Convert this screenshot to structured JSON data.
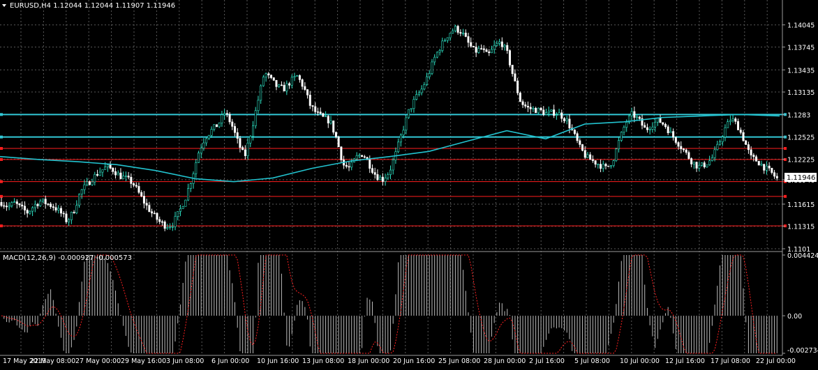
{
  "symbol_header": "EURUSD,H4  1.12044 1.12044 1.11907 1.11946",
  "macd_header": "MACD(12,26,9) -0.000927 -0.000573",
  "current_price_label": "1.11946",
  "colors": {
    "background": "#000000",
    "grid": "#5a5a5a",
    "axis_text": "#ffffff",
    "candle": "#ffffff",
    "bull_wick": "#2ee6c8",
    "ma_line": "#22c3cf",
    "resistance_line": "#32c8d6",
    "support_line": "#ff1e1e",
    "macd_hist": "#bdbdbd",
    "macd_signal": "#ff2020"
  },
  "icons": {
    "symbol_menu": "triangle-down-icon"
  },
  "chart_data": [
    {
      "type": "candlestick",
      "series_shown": "EURUSD,H4",
      "price_axis_ticks": [
        1.14045,
        1.13745,
        1.13435,
        1.13135,
        1.1283,
        1.12525,
        1.12225,
        1.11946,
        1.11615,
        1.11315,
        1.1101
      ],
      "ylim": [
        1.1101,
        1.1425
      ],
      "x_ticks": [
        "17 May 2019",
        "22 May 08:00",
        "27 May 00:00",
        "29 May 16:00",
        "3 Jun 08:00",
        "6 Jun 00:00",
        "10 Jun 16:00",
        "13 Jun 08:00",
        "18 Jun 00:00",
        "20 Jun 16:00",
        "25 Jun 08:00",
        "28 Jun 00:00",
        "2 Jul 16:00",
        "5 Jul 08:00",
        "10 Jul 00:00",
        "12 Jul 16:00",
        "17 Jul 08:00",
        "22 Jul 00:00"
      ],
      "path_closes": [
        1.1164,
        1.1158,
        1.1163,
        1.1156,
        1.115,
        1.116,
        1.1166,
        1.1162,
        1.1158,
        1.115,
        1.1138,
        1.1152,
        1.1178,
        1.1188,
        1.1198,
        1.1206,
        1.1212,
        1.1208,
        1.12,
        1.1196,
        1.119,
        1.1175,
        1.116,
        1.1148,
        1.1138,
        1.1132,
        1.1134,
        1.115,
        1.117,
        1.1198,
        1.1232,
        1.1252,
        1.1262,
        1.127,
        1.1286,
        1.127,
        1.1245,
        1.1225,
        1.126,
        1.13,
        1.134,
        1.133,
        1.132,
        1.1318,
        1.1328,
        1.1335,
        1.132,
        1.1295,
        1.1284,
        1.1278,
        1.1274,
        1.125,
        1.1215,
        1.121,
        1.1225,
        1.123,
        1.1215,
        1.12,
        1.1195,
        1.1205,
        1.123,
        1.126,
        1.1288,
        1.1305,
        1.1318,
        1.1338,
        1.1362,
        1.1378,
        1.1392,
        1.14,
        1.1395,
        1.138,
        1.1368,
        1.1372,
        1.1362,
        1.1375,
        1.1382,
        1.1365,
        1.133,
        1.13,
        1.1292,
        1.129,
        1.1288,
        1.1284,
        1.1286,
        1.1283,
        1.1275,
        1.1258,
        1.1238,
        1.1225,
        1.122,
        1.1215,
        1.121,
        1.122,
        1.1248,
        1.1272,
        1.1284,
        1.1275,
        1.1262,
        1.127,
        1.1275,
        1.1268,
        1.1255,
        1.1244,
        1.1232,
        1.122,
        1.1212,
        1.1215,
        1.1222,
        1.124,
        1.1262,
        1.1278,
        1.1268,
        1.1248,
        1.1225,
        1.122,
        1.1212,
        1.1205,
        1.1196
      ],
      "moving_average": [
        [
          0,
          1.1226
        ],
        [
          0.05,
          1.1222
        ],
        [
          0.1,
          1.1219
        ],
        [
          0.15,
          1.1215
        ],
        [
          0.2,
          1.1207
        ],
        [
          0.25,
          1.1196
        ],
        [
          0.3,
          1.1192
        ],
        [
          0.35,
          1.1197
        ],
        [
          0.4,
          1.121
        ],
        [
          0.45,
          1.122
        ],
        [
          0.5,
          1.1226
        ],
        [
          0.55,
          1.1233
        ],
        [
          0.6,
          1.1247
        ],
        [
          0.65,
          1.1261
        ],
        [
          0.7,
          1.125
        ],
        [
          0.75,
          1.127
        ],
        [
          0.8,
          1.1273
        ],
        [
          0.85,
          1.1279
        ],
        [
          0.9,
          1.1281
        ],
        [
          0.95,
          1.1283
        ],
        [
          1.0,
          1.1281
        ]
      ],
      "horizontal_lines": [
        {
          "price": 1.1283,
          "color": "#32c8d6",
          "width": 2
        },
        {
          "price": 1.12525,
          "color": "#32c8d6",
          "width": 2
        },
        {
          "price": 1.1237,
          "color": "#ff1e1e",
          "width": 1
        },
        {
          "price": 1.1222,
          "color": "#ff1e1e",
          "width": 1
        },
        {
          "price": 1.1192,
          "color": "#ff1e1e",
          "width": 1
        },
        {
          "price": 1.1172,
          "color": "#ff1e1e",
          "width": 1
        },
        {
          "price": 1.1132,
          "color": "#ff1e1e",
          "width": 1
        }
      ]
    },
    {
      "type": "bar",
      "series_shown": "MACD(12,26,9)",
      "axis_ticks": [
        0.004424,
        0.0,
        -0.002734
      ],
      "axis_tick_labels": [
        "0.004424",
        "0.00",
        "-0.002734"
      ],
      "ylim": [
        -0.002734,
        0.004424
      ]
    }
  ]
}
